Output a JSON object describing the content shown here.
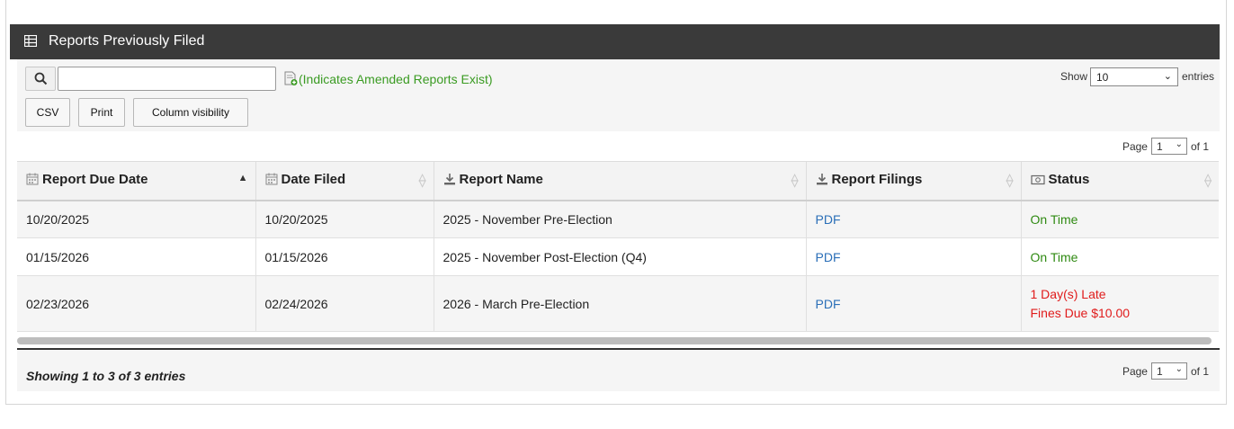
{
  "panel": {
    "title": "Reports Previously Filed",
    "title_icon": "table-grid-icon"
  },
  "toolbar": {
    "search_icon": "search-icon",
    "search_value": "",
    "amended_icon": "amended-document-icon",
    "amended_note": "(Indicates Amended Reports Exist)",
    "show_label": "Show",
    "entries_value": "10",
    "entries_label": "entries",
    "buttons": [
      "CSV",
      "Print",
      "Column visibility"
    ]
  },
  "pagination": {
    "page_label": "Page",
    "current_page": "1",
    "of_label": "of 1"
  },
  "table": {
    "columns": [
      {
        "label": "Report Due Date",
        "icon": "calendar-icon"
      },
      {
        "label": "Date Filed",
        "icon": "calendar-icon"
      },
      {
        "label": "Report Name",
        "icon": "download-icon"
      },
      {
        "label": "Report Filings",
        "icon": "download-icon"
      },
      {
        "label": "Status",
        "icon": "money-icon"
      }
    ],
    "rows": [
      {
        "due": "10/20/2025",
        "filed": "10/20/2025",
        "name": "2025 - November Pre-Election",
        "filing": "PDF",
        "status": "On Time",
        "status2": ""
      },
      {
        "due": "01/15/2026",
        "filed": "01/15/2026",
        "name": "2025 - November Post-Election (Q4)",
        "filing": "PDF",
        "status": "On Time",
        "status2": ""
      },
      {
        "due": "02/23/2026",
        "filed": "02/24/2026",
        "name": "2026 - March Pre-Election",
        "filing": "PDF",
        "status": "1 Day(s) Late",
        "status2": "Fines Due $10.00"
      }
    ]
  },
  "footer": {
    "showing": "Showing 1 to 3 of 3 entries"
  },
  "colors": {
    "header_bg": "#3a3a3a",
    "link": "#2b6fb8",
    "on_time": "#2f8a12",
    "late": "#e01b1b",
    "amended_note": "#3a9b22"
  }
}
